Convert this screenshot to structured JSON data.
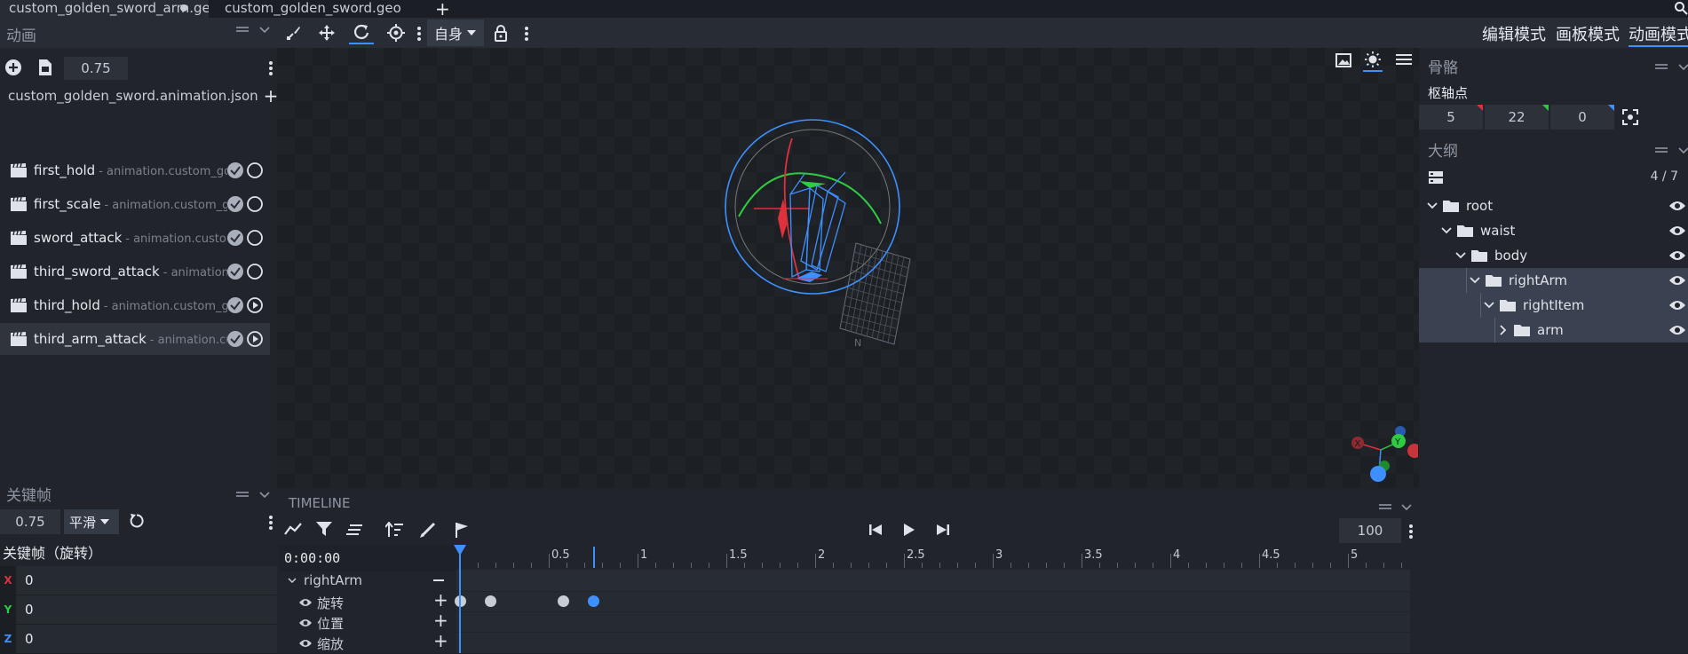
{
  "tabs": [
    {
      "label": "custom_golden_sword_arm.geo",
      "modified": true
    },
    {
      "label": "custom_golden_sword.geo",
      "modified": false
    }
  ],
  "toolbar": {
    "space_select": "自身",
    "modes": [
      "编辑模式",
      "画板模式",
      "动画模式"
    ],
    "active_mode": "动画模式"
  },
  "animation_panel": {
    "title": "动画",
    "speed_value": "0.75",
    "file_name": "custom_golden_sword.animation.json",
    "animations": [
      {
        "name": "first_hold",
        "sub": "- animation.custom_golden_sword.first_hold",
        "state": "circle"
      },
      {
        "name": "first_scale",
        "sub": "- animation.custom_golden_sword.first_scale",
        "state": "circle"
      },
      {
        "name": "sword_attack",
        "sub": "- animation.custom_golden_sword.sword_attack",
        "state": "circle"
      },
      {
        "name": "third_sword_attack",
        "sub": "- animation.custom_golden_sword.third_sword_attack",
        "state": "circle"
      },
      {
        "name": "third_hold",
        "sub": "- animation.custom_golden_sword.third_hold",
        "state": "play"
      },
      {
        "name": "third_arm_attack",
        "sub": "- animation.custom_golden_sword.third_arm_attack",
        "state": "play"
      }
    ],
    "selected_index": 5
  },
  "keyframe_panel": {
    "title": "关键帧",
    "time_value": "0.75",
    "interpolation": "平滑",
    "section_label": "关键帧（旋转）",
    "axes": [
      {
        "axis": "X",
        "value": "0",
        "color": "#e0303c"
      },
      {
        "axis": "Y",
        "value": "0",
        "color": "#2ecc40"
      },
      {
        "axis": "Z",
        "value": "0",
        "color": "#3e90ff"
      }
    ]
  },
  "bone_panel": {
    "title": "骨骼",
    "pivot_label": "枢轴点",
    "pivot": [
      "5",
      "22",
      "0"
    ]
  },
  "outliner": {
    "title": "大纲",
    "count": "4 / 7",
    "items": [
      {
        "label": "root",
        "depth": 0,
        "expanded": true,
        "selected": false
      },
      {
        "label": "waist",
        "depth": 1,
        "expanded": true,
        "selected": false
      },
      {
        "label": "body",
        "depth": 2,
        "expanded": true,
        "selected": false
      },
      {
        "label": "rightArm",
        "depth": 3,
        "expanded": true,
        "selected": true
      },
      {
        "label": "rightItem",
        "depth": 4,
        "expanded": true,
        "selected": true
      },
      {
        "label": "arm",
        "depth": 5,
        "expanded": false,
        "selected": true
      }
    ]
  },
  "timeline": {
    "title": "TIMELINE",
    "time_display": "0:00:00",
    "zoom_value": "100",
    "tick_labels": [
      "0.5",
      "1",
      "1.5",
      "2",
      "2.5",
      "3",
      "3.5",
      "4",
      "4.5",
      "5"
    ],
    "bone_name": "rightArm",
    "channels": [
      "旋转",
      "位置",
      "缩放"
    ],
    "keyframe_times": [
      0,
      0.17,
      0.58,
      0.75
    ],
    "selected_keyframe_time": 0.75,
    "playhead_time": 0,
    "marker_time": 0.75
  },
  "viewport": {
    "gizmo_axes": [
      "X",
      "Y"
    ],
    "ground_label": "N"
  },
  "colors": {
    "accent": "#3e90ff",
    "x_axis": "#e0303c",
    "y_axis": "#2ecc40",
    "z_axis": "#3e90ff"
  }
}
